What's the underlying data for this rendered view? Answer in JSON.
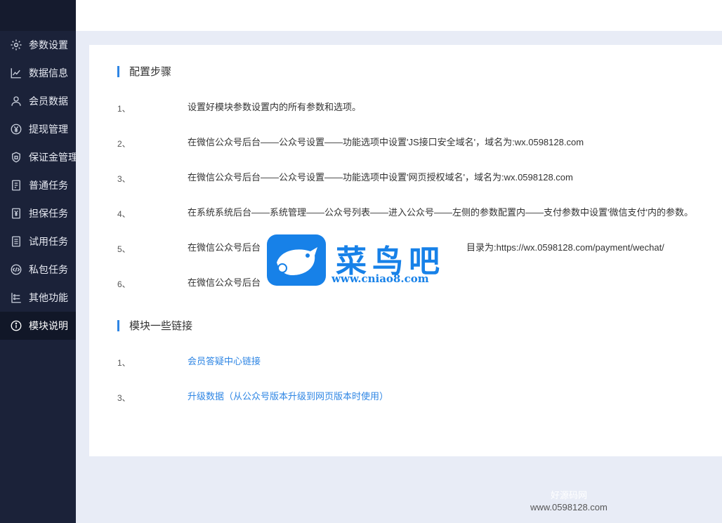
{
  "sidebar": {
    "items": [
      {
        "label": "参数设置",
        "icon": "gear-icon"
      },
      {
        "label": "数据信息",
        "icon": "line-chart-icon"
      },
      {
        "label": "会员数据",
        "icon": "user-icon"
      },
      {
        "label": "提现管理",
        "icon": "yen-circle-icon"
      },
      {
        "label": "保证金管理",
        "icon": "shield-icon"
      },
      {
        "label": "普通任务",
        "icon": "document-icon"
      },
      {
        "label": "担保任务",
        "icon": "yen-document-icon"
      },
      {
        "label": "试用任务",
        "icon": "list-icon"
      },
      {
        "label": "私包任务",
        "icon": "code-circle-icon"
      },
      {
        "label": "其他功能",
        "icon": "settings-list-icon"
      },
      {
        "label": "模块说明",
        "icon": "info-icon",
        "active": true
      }
    ]
  },
  "config_section": {
    "title": "配置步骤",
    "steps": [
      {
        "num": "1、",
        "text": "设置好模块参数设置内的所有参数和选项。"
      },
      {
        "num": "2、",
        "text": "在微信公众号后台——公众号设置——功能选项中设置'JS接口安全域名'，域名为:wx.0598128.com"
      },
      {
        "num": "3、",
        "text": "在微信公众号后台——公众号设置——功能选项中设置'网页授权域名'，域名为:wx.0598128.com"
      },
      {
        "num": "4、",
        "text": "在系统系统后台——系统管理——公众号列表——进入公众号——左侧的参数配置内——支付参数中设置'微信支付'内的参数。"
      },
      {
        "num": "5、",
        "text": "在微信公众号后台",
        "text_suffix": "目录为:https://wx.0598128.com/payment/wechat/"
      },
      {
        "num": "6、",
        "text": "在微信公众号后台"
      }
    ]
  },
  "links_section": {
    "title": "模块一些链接",
    "links": [
      {
        "num": "1、",
        "text": "会员答疑中心链接"
      },
      {
        "num": "3、",
        "text": "升级数据（从公众号版本升级到网页版本时使用）"
      }
    ]
  },
  "watermark": {
    "title": "菜鸟吧",
    "url": "www.cniao8.com"
  },
  "footer": {
    "brand": "好源码网",
    "url": "www.0598128.com"
  },
  "colors": {
    "sidebar_bg": "#1b2239",
    "accent": "#2f86e4",
    "watermark": "#1781e8"
  }
}
